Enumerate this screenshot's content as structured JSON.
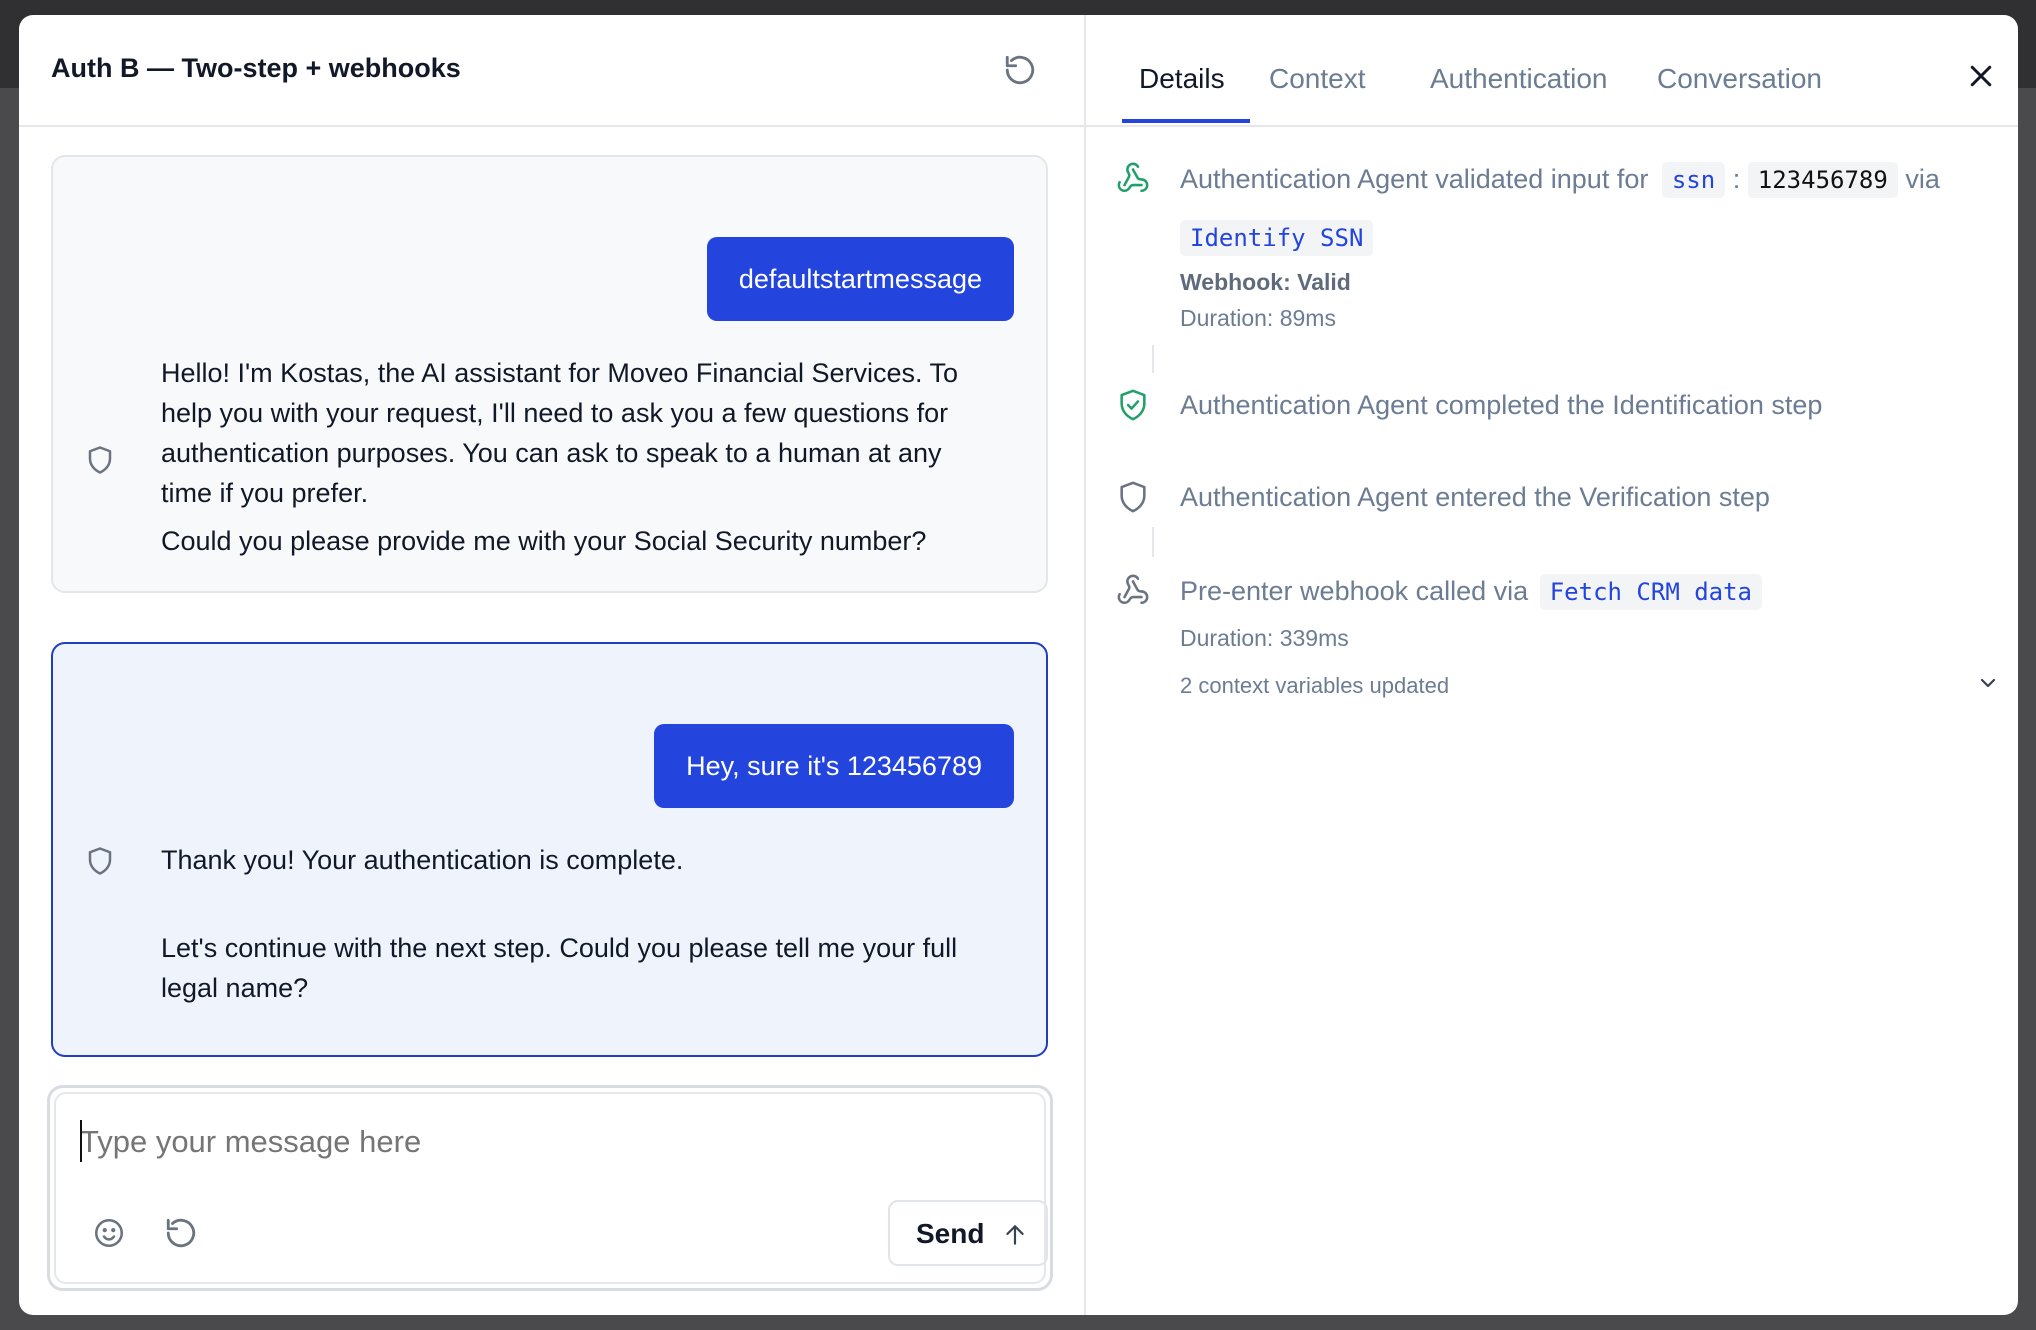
{
  "header": {
    "title": "Auth B — Two-step + webhooks"
  },
  "messages": [
    {
      "user": "defaultstartmessage",
      "bot_lines": [
        "Hello! I'm Kostas, the AI assistant for Moveo Financial Services. To",
        "help you with your request, I'll need to ask you a few questions for",
        "authentication purposes. You can ask to speak to a human at any",
        "time if you prefer."
      ],
      "bot_followup": "Could you please provide me with your Social Security number?"
    },
    {
      "user": "Hey, sure it's 123456789",
      "bot_lines": [
        "Thank you! Your authentication is complete."
      ],
      "bot_followup_lines": [
        "Let's continue with the next step. Could you please tell me your full",
        "legal name?"
      ]
    }
  ],
  "composer": {
    "placeholder": "Type your message here",
    "send_label": "Send"
  },
  "tabs": [
    "Details",
    "Context",
    "Authentication",
    "Conversation"
  ],
  "active_tab": "Details",
  "events": [
    {
      "icon": "webhook-icon",
      "text_prefix": "Authentication Agent validated input for",
      "var": "ssn",
      "colon": ":",
      "value": "123456789",
      "via": "via",
      "webhook_name": "Identify SSN",
      "status": "Webhook: Valid",
      "duration": "Duration: 89ms"
    },
    {
      "icon": "shield-check-icon",
      "text": "Authentication Agent completed the Identification step"
    },
    {
      "icon": "shield-icon",
      "text": "Authentication Agent entered the Verification step"
    },
    {
      "icon": "webhook-icon",
      "text_prefix": "Pre-enter webhook called via",
      "webhook_name": "Fetch CRM data",
      "duration": "Duration: 339ms",
      "context_updates": "2 context variables updated"
    }
  ],
  "colors": {
    "accent": "#2344dd",
    "success": "#22a06b",
    "muted": "#6b7c93"
  }
}
